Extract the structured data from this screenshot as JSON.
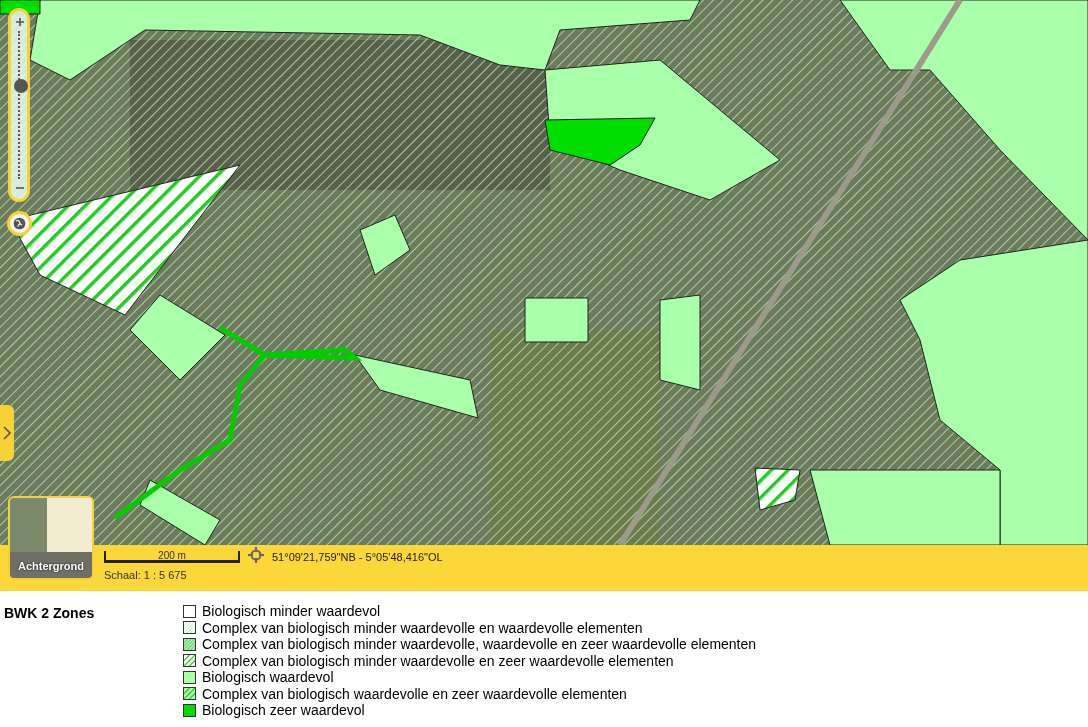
{
  "zoom": {
    "level": 0.63
  },
  "background_button": {
    "label": "Achtergrond"
  },
  "scale_bar": {
    "label": "200 m"
  },
  "coordinates": "51°09'21,759\"NB - 5°05'48,416\"OL",
  "scale": "Schaal: 1 : 5 675",
  "legend": {
    "title": "BWK 2 Zones",
    "items": [
      {
        "label": "Biologisch minder waardevol",
        "kind": "plain",
        "color": "#ffffff"
      },
      {
        "label": "Complex van biologisch minder waardevolle en waardevolle elementen",
        "kind": "fine-hatch",
        "color": "#ffffff"
      },
      {
        "label": "Complex van biologisch minder waardevolle, waardevolle en zeer waardevolle elementen",
        "kind": "dense-hatch",
        "color": "#aaf0aa"
      },
      {
        "label": "Complex van biologisch minder waardevolle en zeer waardevolle elementen",
        "kind": "bold-hatch",
        "color": "#ffffff"
      },
      {
        "label": "Biologisch waardevol",
        "kind": "plain",
        "color": "#aaffaa"
      },
      {
        "label": "Complex van biologisch waardevolle en zeer waardevolle elementen",
        "kind": "bold-hatch",
        "color": "#aaffaa"
      },
      {
        "label": "Biologisch zeer waardevol",
        "kind": "plain",
        "color": "#00dd00"
      }
    ]
  }
}
